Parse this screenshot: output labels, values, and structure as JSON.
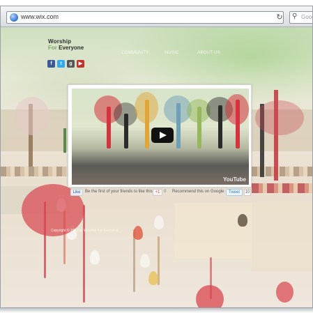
{
  "browser": {
    "url": "www.wix.com",
    "search_placeholder": "Goog"
  },
  "site": {
    "logo_line1": "Worship",
    "logo_for": "For",
    "logo_everyone": "Everyone",
    "nav": [
      "COMMUNITY",
      "MUSIC",
      "ABOUT US"
    ],
    "socials": [
      "f",
      "t",
      "g",
      "▶"
    ]
  },
  "video": {
    "brand": "YouTube"
  },
  "share": {
    "like_label": "Like",
    "like_text": "Be the first of your friends to like this.",
    "plus_label": "+1",
    "plus_count": "0",
    "plus_text": "Recommend this on Google",
    "tweet_label": "Tweet",
    "tweet_count": "10"
  },
  "footer": {
    "copyright": "Copyright © 2013 by Worship For Everyone"
  },
  "colors": {
    "accent_green": "#7ea86c",
    "facebook": "#3b5998",
    "twitter": "#33aaf0",
    "youtube": "#c4302b"
  }
}
